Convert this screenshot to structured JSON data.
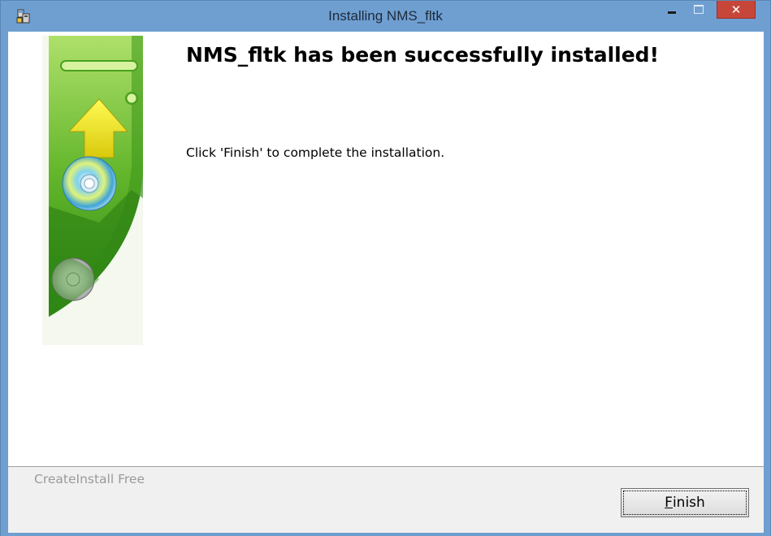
{
  "window": {
    "title": "Installing NMS_fltk",
    "app_icon": "installer-icon",
    "controls": {
      "minimize_icon": "minimize-icon",
      "maximize_icon": "maximize-icon",
      "close_icon": "close-icon",
      "close_glyph": "✕"
    },
    "colors": {
      "frame": "#6f9fd1",
      "close_button": "#c7463a"
    }
  },
  "banner": {
    "image": "installer-banner-disc-arrow",
    "colors": {
      "green_dark": "#3f9c1c",
      "green_light": "#9ad65a",
      "arrow_yellow": "#f0e617"
    }
  },
  "content": {
    "heading": "NMS_fltk has been successfully installed!",
    "message": "Click 'Finish' to complete the installation."
  },
  "footer": {
    "brand": "CreateInstall Free",
    "finish_mnemonic": "F",
    "finish_rest": "inish"
  }
}
